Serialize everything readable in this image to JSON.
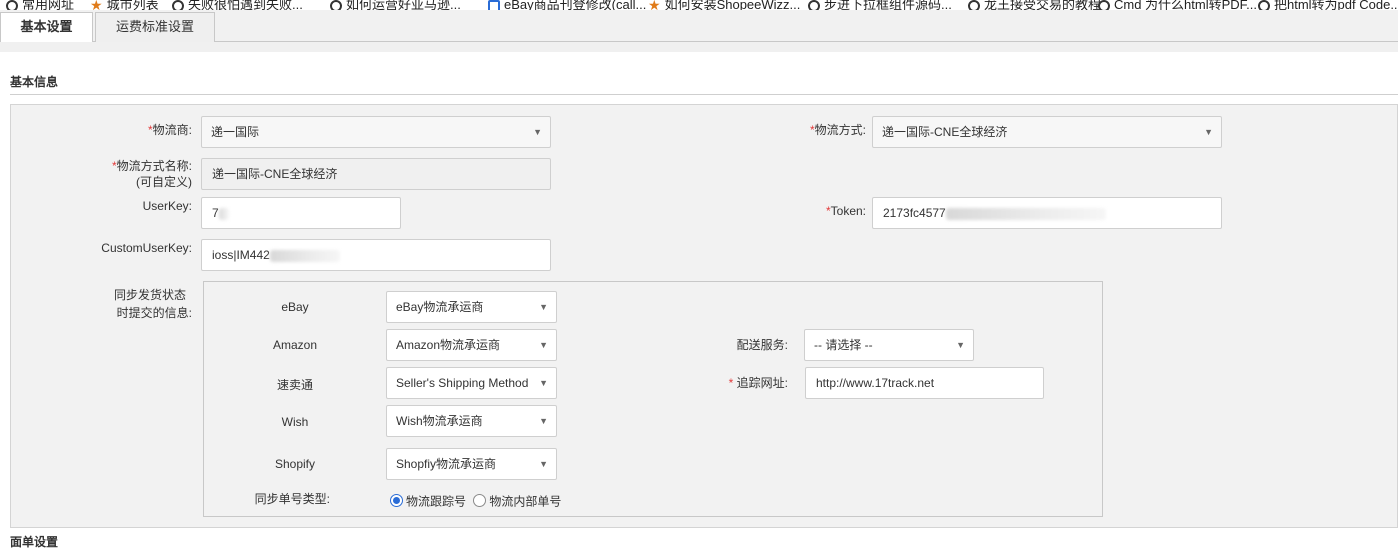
{
  "bookmarks": [
    {
      "icon": "folder-icon",
      "label": "常用网址"
    },
    {
      "icon": "star-icon",
      "label": "城市列表"
    },
    {
      "icon": "globe-icon",
      "label": "失败很怕遇到失败..."
    },
    {
      "icon": "globe-icon",
      "label": "如何运营好亚马逊..."
    },
    {
      "icon": "ebay-icon",
      "label": "eBay商品刊登修改(call..."
    },
    {
      "icon": "star-icon",
      "label": "如何安装ShopeeWizz..."
    },
    {
      "icon": "globe-icon",
      "label": "步进下拉框组件源码..."
    },
    {
      "icon": "globe-icon",
      "label": "龙王接受交易的教程"
    },
    {
      "icon": "globe-icon",
      "label": "Cmd 为什么html转PDF..."
    },
    {
      "icon": "globe-icon",
      "label": "把html转为pdf Code..."
    }
  ],
  "tabs": [
    {
      "label": "基本设置",
      "active": true
    },
    {
      "label": "运费标准设置",
      "active": false
    }
  ],
  "sections": {
    "basic_info": "基本信息",
    "form_settings": "面单设置"
  },
  "form": {
    "carrier": {
      "required": "*",
      "label": "物流商:",
      "value": "递一国际"
    },
    "shipping_method": {
      "required": "*",
      "label": "物流方式:",
      "value": "递一国际-CNE全球经济"
    },
    "method_name": {
      "required": "*",
      "label": "物流方式名称:",
      "sublabel": "(可自定义)",
      "value": "递一国际-CNE全球经济"
    },
    "userkey": {
      "label": "UserKey:",
      "value": "7"
    },
    "token": {
      "required": "*",
      "label": "Token:",
      "value": "2173fc4577"
    },
    "custom_userkey": {
      "label": "CustomUserKey:",
      "value": "ioss|IM442"
    },
    "sync_info": {
      "label_line1": "同步发货状态",
      "label_line2": "时提交的信息:"
    }
  },
  "platforms": [
    {
      "name": "eBay",
      "value": "eBay物流承运商"
    },
    {
      "name": "Amazon",
      "value": "Amazon物流承运商"
    },
    {
      "name": "速卖通",
      "value": "Seller's Shipping Method"
    },
    {
      "name": "Wish",
      "value": "Wish物流承运商"
    },
    {
      "name": "Shopify",
      "value": "Shopfiy物流承运商"
    }
  ],
  "delivery_service": {
    "label": "配送服务:",
    "value": "-- 请选择 --"
  },
  "tracking_url": {
    "required": "*",
    "label": "追踪网址:",
    "value": "http://www.17track.net"
  },
  "sync_number_type": {
    "label": "同步单号类型:",
    "options": [
      {
        "label": "物流跟踪号",
        "checked": true
      },
      {
        "label": "物流内部单号",
        "checked": false
      }
    ]
  },
  "colors": {
    "required": "#e23b3b",
    "radio_selected": "#2a6cd6",
    "panel_bg": "#f2f2f2"
  }
}
